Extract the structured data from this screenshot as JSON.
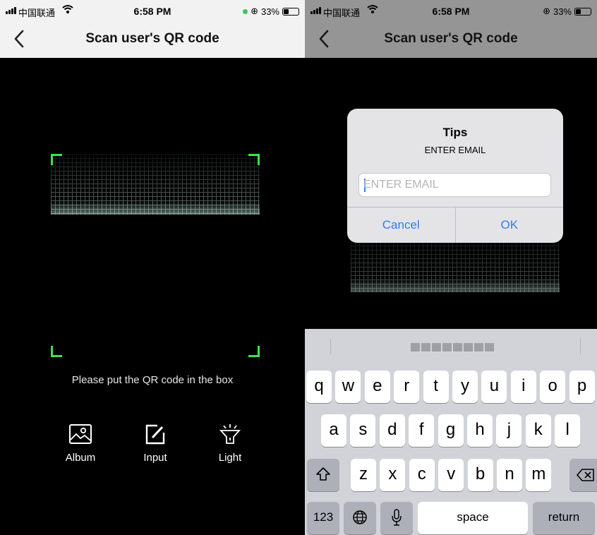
{
  "left": {
    "status": {
      "carrier": "中国联通",
      "time": "6:58 PM",
      "battery": "33%",
      "battery_level": 0.33
    },
    "nav": {
      "title": "Scan user's QR code"
    },
    "hint": "Please put the QR code in the box",
    "tools": [
      {
        "label": "Album",
        "icon": "album-icon"
      },
      {
        "label": "Input",
        "icon": "edit-icon"
      },
      {
        "label": "Light",
        "icon": "flashlight-icon"
      }
    ],
    "accent_color": "#3fe24a"
  },
  "right": {
    "status": {
      "carrier": "中国联通",
      "time": "6:58 PM",
      "battery": "33%",
      "battery_level": 0.33
    },
    "nav": {
      "title": "Scan user's QR code"
    },
    "alert": {
      "title": "Tips",
      "message": "ENTER EMAIL",
      "input_placeholder": "ENTER EMAIL",
      "input_value": "",
      "cancel_label": "Cancel",
      "ok_label": "OK"
    },
    "keyboard": {
      "row1": [
        "q",
        "w",
        "e",
        "r",
        "t",
        "y",
        "u",
        "i",
        "o",
        "p"
      ],
      "row2": [
        "a",
        "s",
        "d",
        "f",
        "g",
        "h",
        "j",
        "k",
        "l"
      ],
      "row3": [
        "z",
        "x",
        "c",
        "v",
        "b",
        "n",
        "m"
      ],
      "numbers_label": "123",
      "space_label": "space",
      "return_label": "return"
    },
    "link_color": "#2f7cf6"
  }
}
